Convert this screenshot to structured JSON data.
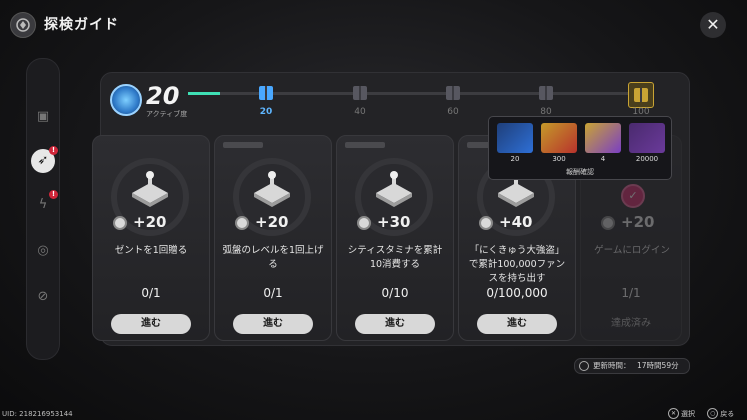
{
  "header": {
    "title": "探検ガイド",
    "close_glyph": "✕"
  },
  "sidebar": {
    "items": [
      {
        "icon": "calendar-icon",
        "glyph": "▣",
        "active": false,
        "badge": false
      },
      {
        "icon": "runner-icon",
        "glyph": "➶",
        "active": true,
        "badge": true
      },
      {
        "icon": "lightning-icon",
        "glyph": "ϟ",
        "active": false,
        "badge": true
      },
      {
        "icon": "target-icon",
        "glyph": "◎",
        "active": false,
        "badge": false
      },
      {
        "icon": "compass-icon",
        "glyph": "⊘",
        "active": false,
        "badge": false
      }
    ],
    "badge_glyph": "!"
  },
  "activity": {
    "value": "20",
    "label": "アクティブ度"
  },
  "milestones": [
    {
      "value": "20",
      "active": true
    },
    {
      "value": "40",
      "active": false
    },
    {
      "value": "60",
      "active": false
    },
    {
      "value": "80",
      "active": false
    },
    {
      "value": "100",
      "active": false
    }
  ],
  "progress_fraction": 0.2,
  "tasks": [
    {
      "reward": "+20",
      "desc": "ゼントを1回贈る",
      "progress": "0/1",
      "button": "進む"
    },
    {
      "reward": "+20",
      "desc": "弧盤のレベルを1回上げる",
      "progress": "0/1",
      "button": "進む"
    },
    {
      "reward": "+30",
      "desc": "シティスタミナを累計10消費する",
      "progress": "0/10",
      "button": "進む"
    },
    {
      "reward": "+40",
      "desc": "「にくきゅう大強盗」で累計100,000ファンスを持ち出す",
      "progress": "0/100,000",
      "button": "進む"
    },
    {
      "reward": "+20",
      "desc": "ゲームにログイン",
      "progress": "1/1",
      "button": "達成済み"
    }
  ],
  "reward_popup": {
    "items": [
      {
        "icon": "polychrome-icon",
        "qty": "20",
        "color": "#2e6fd6"
      },
      {
        "icon": "hamster-ticket-icon",
        "qty": "300",
        "color": "#b8322c"
      },
      {
        "icon": "material-orb-icon",
        "qty": "4",
        "color": "#7a3fc4"
      },
      {
        "icon": "key-icon",
        "qty": "20000",
        "color": "#6a3a9a"
      }
    ],
    "footer": "報酬確認"
  },
  "update_time": {
    "label": "更新時間：",
    "value": "17時間59分"
  },
  "uid": "UID: 218216953144",
  "hints": [
    {
      "key": "✕",
      "label": "選択"
    },
    {
      "key": "○",
      "label": "戻る"
    }
  ]
}
